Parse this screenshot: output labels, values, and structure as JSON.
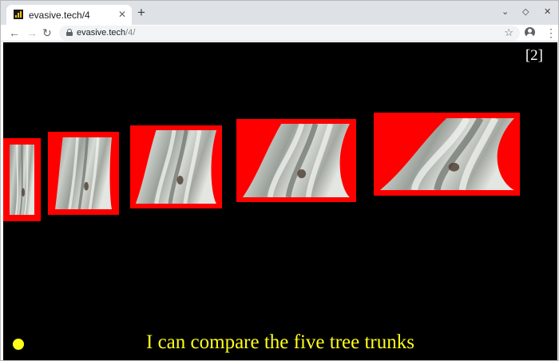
{
  "browser": {
    "tab_title": "evasive.tech/4",
    "tab_close_glyph": "✕",
    "new_tab_glyph": "+",
    "window_controls": {
      "minimize_glyph": "⌄",
      "maximize_glyph": "◇",
      "close_glyph": "✕"
    },
    "nav": {
      "back_glyph": "←",
      "forward_glyph": "→",
      "reload_glyph": "↻"
    },
    "url_host": "evasive.tech",
    "url_path": "/4/",
    "bookmark_glyph": "☆",
    "menu_glyph": "⋮"
  },
  "slide": {
    "number": "[2]",
    "caption": "I can compare the five tree trunks",
    "trunk_count": 5
  },
  "colors": {
    "background": "#000000",
    "frame": "#ff0000",
    "caption": "#ffff1a",
    "slide_number": "#ffffff"
  },
  "icons": {
    "favicon": "bar-chart-icon",
    "lock": "lock-icon",
    "profile": "account-circle-icon",
    "bookmark": "star-icon",
    "menu": "kebab-menu-icon"
  }
}
